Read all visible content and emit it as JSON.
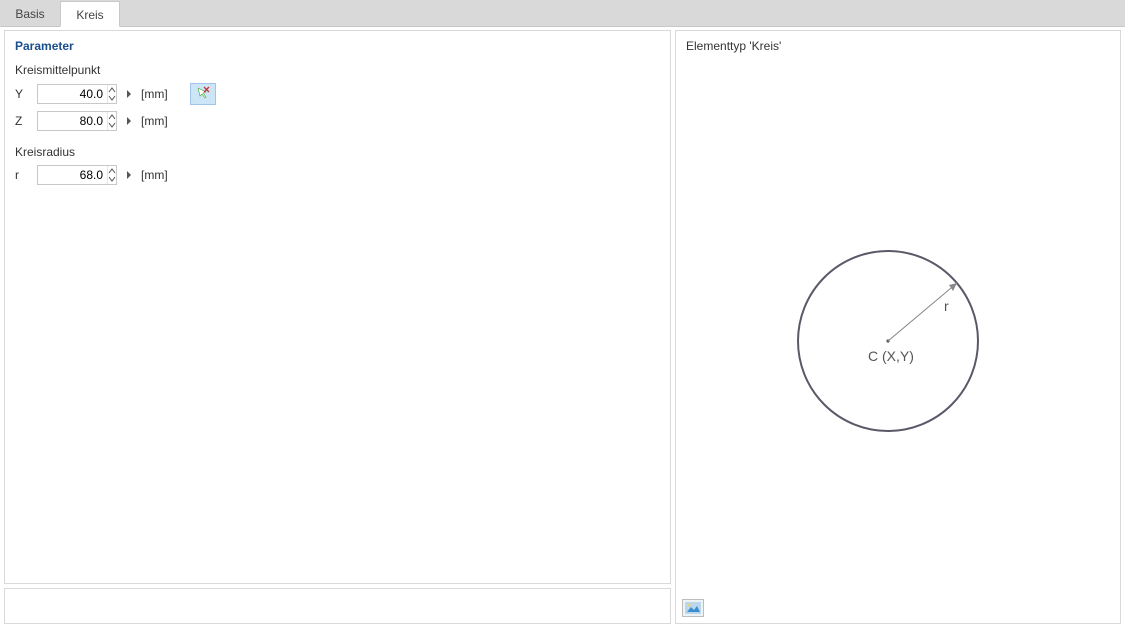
{
  "tabs": {
    "basis": "Basis",
    "kreis": "Kreis"
  },
  "left": {
    "title": "Parameter",
    "groupCenter": "Kreismittelpunkt",
    "groupRadius": "Kreisradius",
    "y": {
      "label": "Y",
      "value": "40.0",
      "unit": "[mm]"
    },
    "z": {
      "label": "Z",
      "value": "80.0",
      "unit": "[mm]"
    },
    "r": {
      "label": "r",
      "value": "68.0",
      "unit": "[mm]"
    }
  },
  "right": {
    "title": "Elementtyp 'Kreis'",
    "center_label": "C (X,Y)",
    "radius_label": "r"
  }
}
